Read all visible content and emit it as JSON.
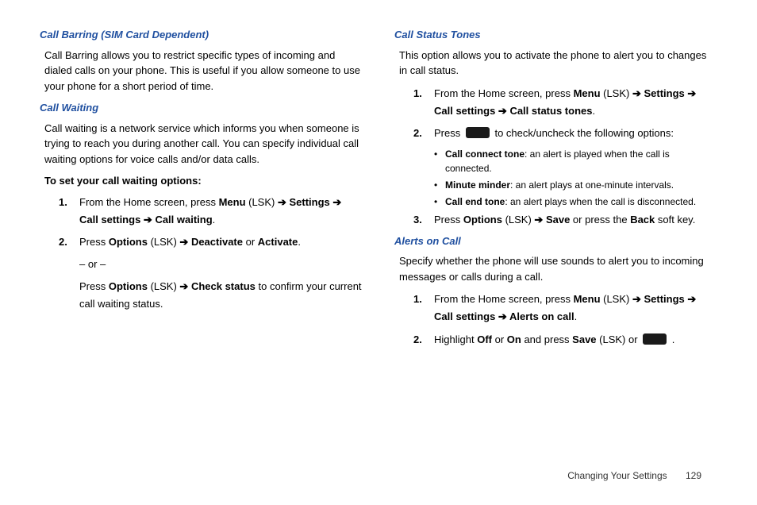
{
  "left": {
    "h1": "Call Barring (SIM Card Dependent)",
    "p1": "Call Barring allows you to restrict specific types of incoming and dialed calls on your phone. This is useful if you allow someone to use your phone for a short period of time.",
    "h2": "Call Waiting",
    "p2": "Call waiting is a network service which informs you when someone is trying to reach you during another call. You can specify individual call waiting options for voice calls and/or data calls.",
    "sh1": "To set your call waiting options:",
    "s1a": "From the Home screen, press ",
    "s1_menu": "Menu",
    "s1b": " (LSK) ",
    "s1_arrow1": "➔",
    "s1_settings": " Settings ",
    "s1_arrow2": "➔",
    "s1c": " ",
    "s1_cs": "Call settings ",
    "s1_arrow3": "➔",
    "s1_cw": " Call waiting",
    "s1d": ".",
    "s2a": "Press ",
    "s2_opt": "Options",
    "s2b": " (LSK) ",
    "s2_arrow": "➔",
    "s2_deact": " Deactivate",
    "s2c": " or ",
    "s2_act": "Activate",
    "s2d": ".",
    "s2e": "– or –",
    "s2f": "Press ",
    "s2_opt2": "Options",
    "s2g": " (LSK) ",
    "s2_arrow2": "➔",
    "s2_chk": " Check status",
    "s2h": " to confirm your current call waiting status."
  },
  "right": {
    "h1": "Call Status Tones",
    "p1": "This option allows you to activate the phone to alert you to changes in call status.",
    "s1a": "From the Home screen, press ",
    "s1_menu": "Menu",
    "s1b": " (LSK) ",
    "s1_arrow1": "➔",
    "s1_settings": " Settings ",
    "s1_arrow2": "➔",
    "s1_cs": "Call settings ",
    "s1_arrow3": "➔",
    "s1_cst": " Call status tones",
    "s1d": ".",
    "s2a": "Press ",
    "s2b": " to check/uncheck the following options:",
    "b1_t": "Call connect tone",
    "b1_d": ": an alert is played when the call is connected.",
    "b2_t": "Minute minder",
    "b2_d": ": an alert plays at one-minute intervals.",
    "b3_t": "Call end tone",
    "b3_d": ": an alert plays when the call is disconnected.",
    "s3a": "Press ",
    "s3_opt": "Options",
    "s3b": " (LSK) ",
    "s3_arrow": "➔",
    "s3_save": " Save",
    "s3c": " or press the ",
    "s3_back": "Back",
    "s3d": " soft key.",
    "h2": "Alerts on Call",
    "p2": "Specify whether the phone will use sounds to alert you to incoming messages or calls during a call.",
    "a1a": "From the Home screen, press ",
    "a1_menu": "Menu",
    "a1b": " (LSK) ",
    "a1_arrow1": "➔",
    "a1_settings": " Settings ",
    "a1_arrow2": "➔",
    "a1_cs": "Call settings ",
    "a1_arrow3": "➔",
    "a1_aoc": " Alerts on call",
    "a1d": ".",
    "a2a": "Highlight ",
    "a2_off": "Off",
    "a2b": " or ",
    "a2_on": "On",
    "a2c": " and press ",
    "a2_save": "Save",
    "a2d": " (LSK) or ",
    "a2e": " ."
  },
  "footer": {
    "section": "Changing Your Settings",
    "page": "129"
  }
}
